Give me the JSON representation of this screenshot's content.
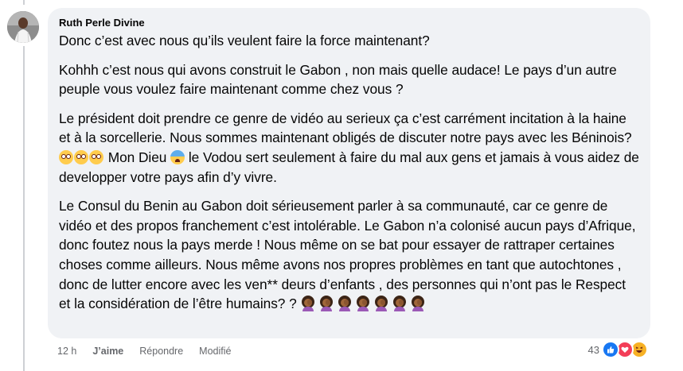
{
  "comment": {
    "author": "Ruth Perle Divine",
    "paragraphs": [
      "Donc c’est avec nous qu’ils veulent faire la force maintenant?",
      "Kohhh c’est nous qui avons construit le Gabon , non mais quelle audace! Le pays d’un autre peuple vous voulez faire maintenant comme chez vous ?",
      {
        "before": "Le président doit prendre ce genre de vidéo au serieux ça c’est carrément incitation à la haine et à la sorcellerie. Nous sommes maintenant obligés de discuter notre pays avec les Béninois?",
        "middle": "Mon Dieu",
        "after": "le Vodou sert seulement à faire du mal aux gens et jamais à vous aidez de developper votre pays afin d’y vivre."
      },
      "Le Consul du Benin au Gabon doit sérieusement parler à sa communauté, car ce genre de vidéo et des propos franchement c’est intolérable. Le Gabon n’a colonisé aucun pays d’Afrique, donc foutez nous la pays merde ! Nous même on se bat pour essayer de rattraper certaines choses comme ailleurs. Nous même avons nos propres problèmes en tant que autochtones , donc de lutter encore avec les ven** deurs d’enfants , des personnes qui n’ont pas le Respect et la considération de l’être humains? ?"
    ]
  },
  "actions": {
    "time": "12 h",
    "like": "J’aime",
    "reply": "Répondre",
    "edited": "Modifié"
  },
  "reactions": {
    "count": "43",
    "types": [
      "like-icon",
      "love-icon",
      "haha-icon"
    ]
  },
  "colors": {
    "bubble": "#f0f2f5",
    "meta_text": "#65676b",
    "like_blue": "#1877f2",
    "love_red": "#f33e58",
    "haha_yellow": "#f7b125"
  }
}
